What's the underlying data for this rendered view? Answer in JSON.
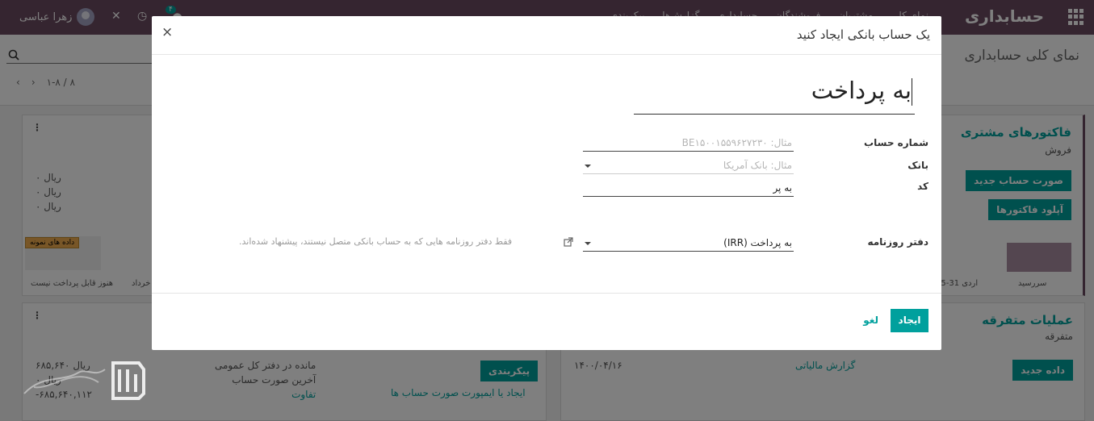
{
  "navbar": {
    "brand": "حسابداری",
    "menu": [
      "نمای کلی",
      "مشتریان",
      "فروشندگان",
      "حسابداری",
      "گزارش‌ها",
      "پیکربندی"
    ],
    "user_name": "زهرا عباسی",
    "chat_count": "۴"
  },
  "control_panel": {
    "title": "نمای کلی حسابداری",
    "pager": "۱-۸ / ۸"
  },
  "cards": {
    "customer_invoices": {
      "title": "فاکتورهای مشتری",
      "subtitle": "فروش",
      "btn_new_bill": "صورت حساب جدید",
      "btn_upload": "آپلود فاکتورها",
      "axis_left": "سررسید",
      "axis_mid": "25-31 اردی"
    },
    "bank_card": {
      "amounts": [
        "۰ ریال",
        "۰ ریال",
        "۰ ریال"
      ],
      "sample_badge": "داده های نمونه",
      "axis_left": "هنوز قابل پرداخت نیست",
      "axis_right": "خرداد"
    },
    "misc": {
      "title": "عملیات متفرقه",
      "subtitle": "متفرقه",
      "btn_new_entry": "داده جدید",
      "date": "۱۴۰۰/۰۴/۱۶",
      "tax_report": "گزارش مالیاتی"
    },
    "bank_bottom": {
      "btn_configure": "پیکربندی",
      "create_import": "ایجاد یا ایمپورت صورت حساب ها",
      "gl_balance": "مانده در دفتر کل عمومی",
      "last_statement": "آخرین صورت حساب",
      "difference": "تفاوت",
      "amounts": [
        "۶۸۵,۶۴۰ ریال",
        "۰ ریال",
        "-۶۸۵,۶۴۰,۱۱۲"
      ]
    }
  },
  "modal": {
    "title": "یک حساب بانکی ایجاد کنید",
    "name_value": "به پرداخت",
    "fields": {
      "account_number_label": "شماره حساب",
      "account_number_placeholder": "مثال: BE۱۵۰۰۱۵۵۹۶۲۷۲۳۰",
      "bank_label": "بانک",
      "bank_placeholder": "مثال: بانک آمریکا",
      "code_label": "کد",
      "code_value": "به پر",
      "journal_label": "دفتر روزنامه",
      "journal_value": "به پرداخت (IRR)",
      "journal_help": "فقط دفتر روزنامه هایی که به حساب بانکی متصل نیستند، پیشنهاد شده‌اند."
    },
    "buttons": {
      "create": "ایجاد",
      "cancel": "لغو"
    }
  },
  "colors": {
    "navbar": "#6b4a61",
    "accent": "#00a09d"
  }
}
